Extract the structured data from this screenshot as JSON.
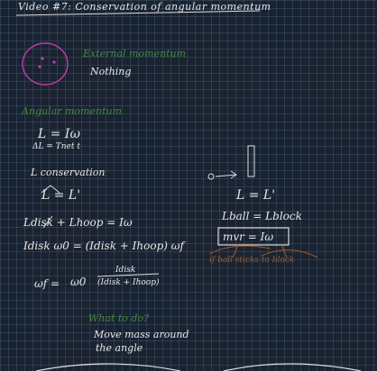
{
  "title": "Video #7: Conservation of angular momentum",
  "section_external": "External momentum",
  "nothing": "Nothing",
  "section_angular": "Angular momentum",
  "eq_L": "L = Iω",
  "eq_dL": "ΔL = Tnet t",
  "conservation": "L conservation",
  "eq_LL": "L = L'",
  "eq_left_1": "Ldisk + Lhoop = Iω",
  "eq_left_2": "Idisk ω0 = (Idisk + Ihoop) ωf",
  "eq_wf_lhs": "ωf =",
  "eq_wf_w0": "ω0",
  "eq_wf_num": "Idisk",
  "eq_wf_den": "(Idisk + Ihoop)",
  "eq_right_LL": "L = L'",
  "eq_right_ball": "Lball = Lblock",
  "eq_right_boxed": "mvr = Iω",
  "orange_note": "if ball sticks to block",
  "section_what": "What to do?",
  "move_mass_1": "Move mass around",
  "move_mass_2": "the angle",
  "colors": {
    "background": "#1b2230",
    "grid": "#466e8c",
    "ink": "#e6e6e6",
    "green": "#3f8a3c",
    "magenta": "#c43ca8",
    "orange": "#9a5a2a"
  }
}
